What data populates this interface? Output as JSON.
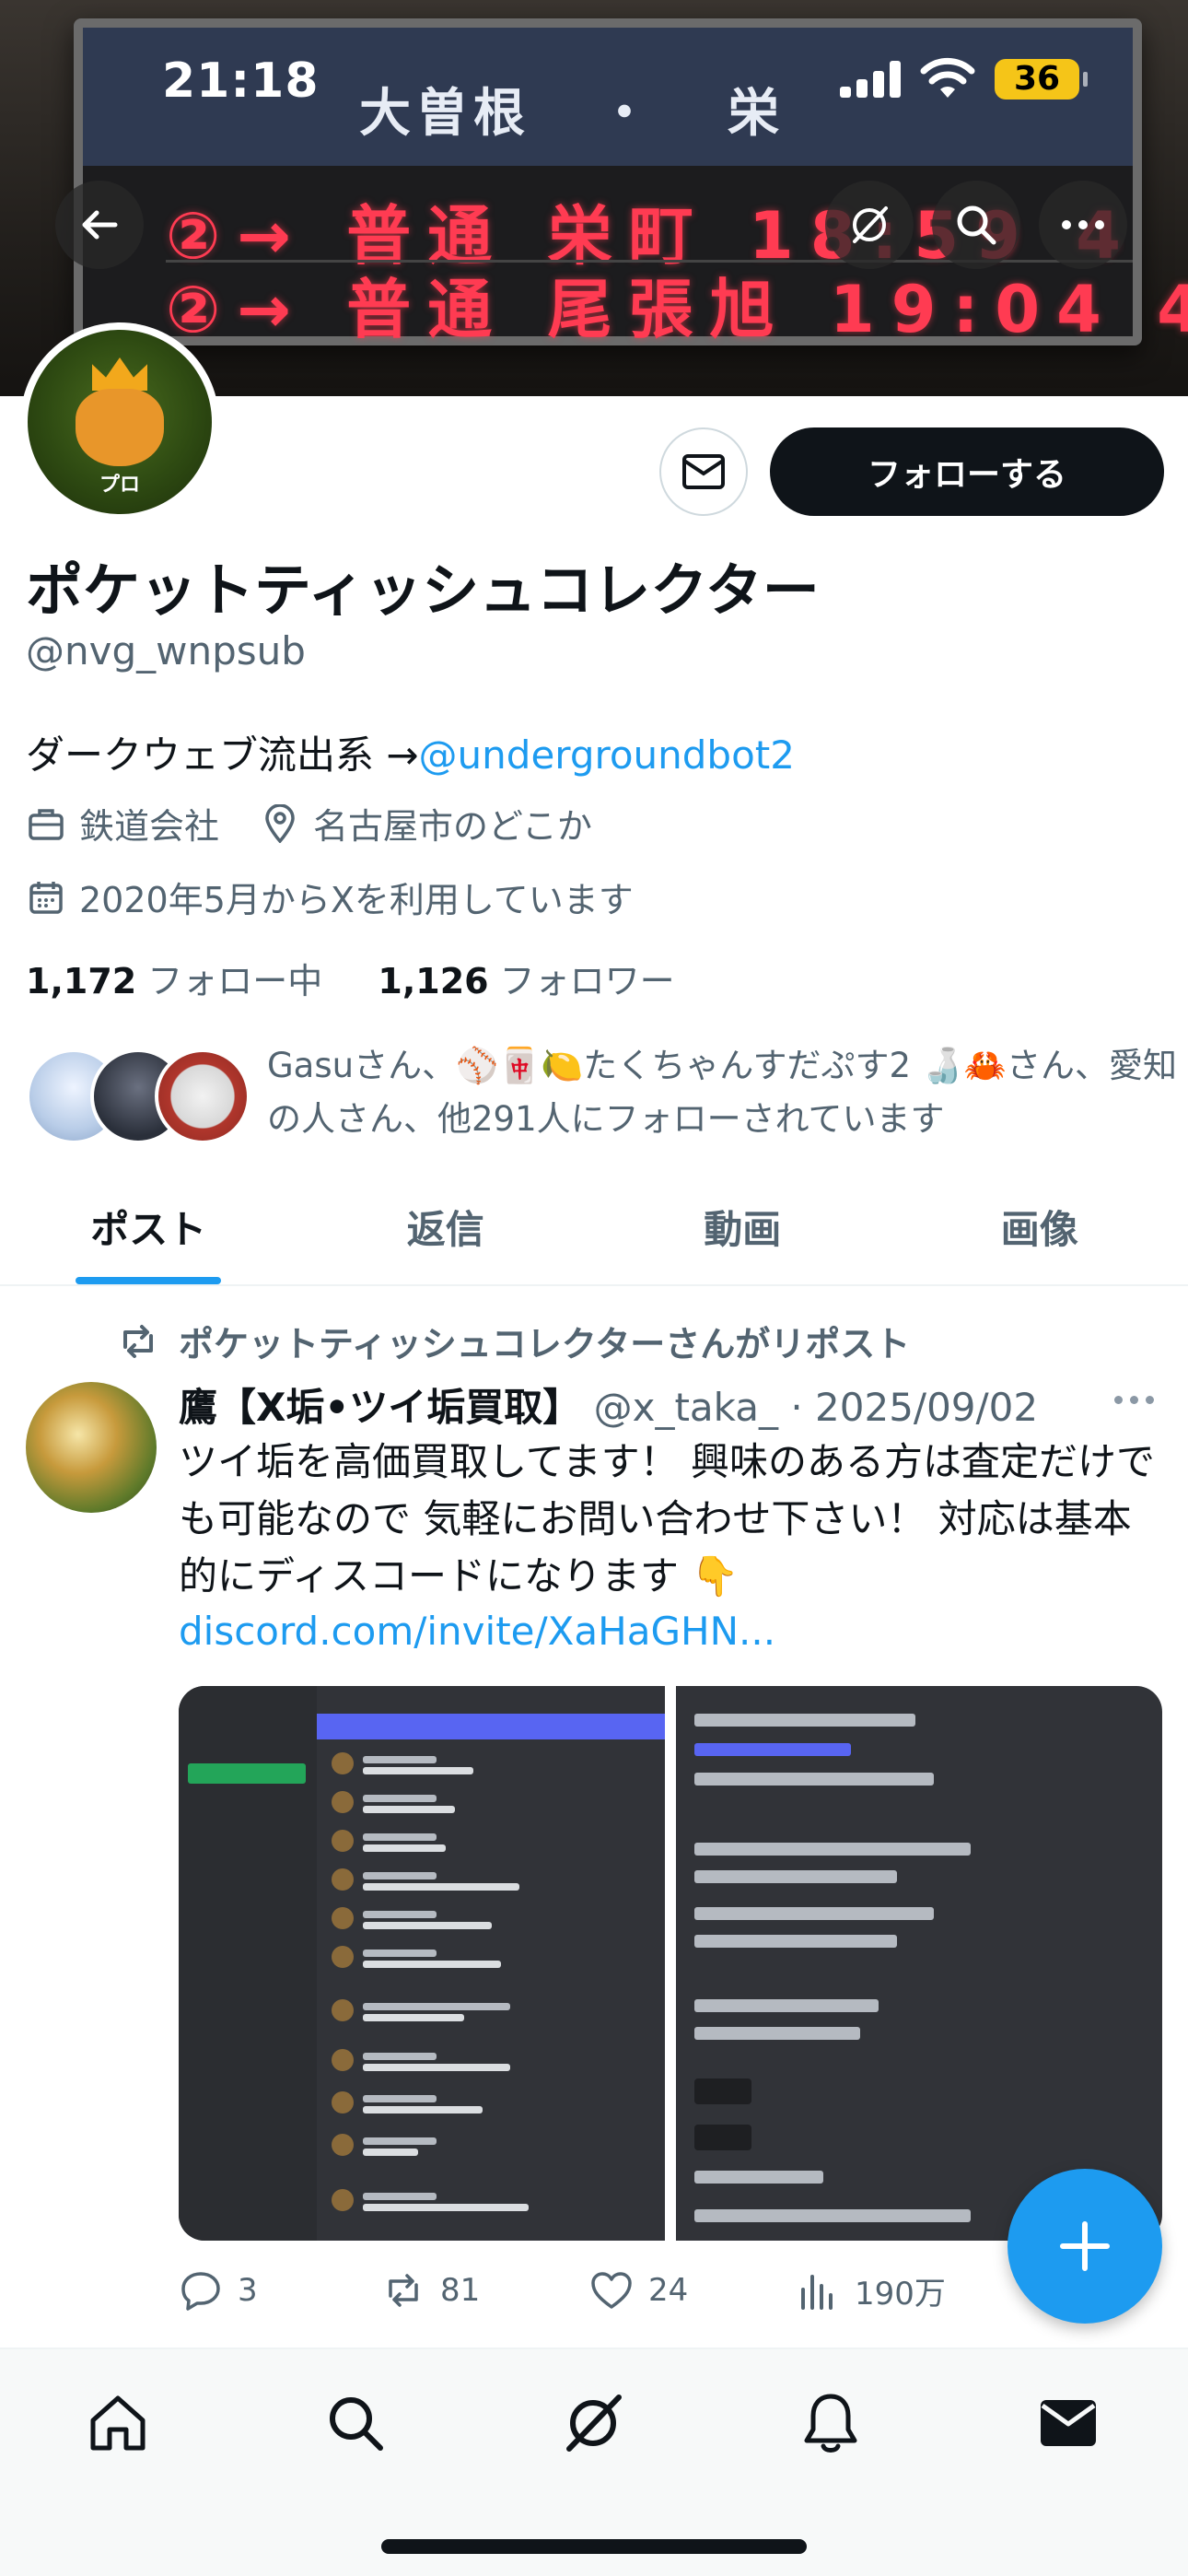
{
  "status_bar": {
    "time": "21:18",
    "battery": "36"
  },
  "banner": {
    "station_left": "大曽根",
    "station_dot": "・",
    "station_right": "栄",
    "row1": "②→ 普通 栄町  18:59 4",
    "row2": "②→ 普通 尾張旭 19:04 4",
    "icons": [
      "back-arrow-icon",
      "grok-icon",
      "search-icon",
      "more-icon"
    ]
  },
  "profile": {
    "avatar_text": "プロ",
    "follow_label": "フォローする",
    "display_name": "ポケットティッシュコレクター",
    "handle": "@nvg_wnpsub",
    "bio_text": "ダークウェブ流出系 →",
    "bio_link": "@undergroundbot2",
    "job": "鉄道会社",
    "location": "名古屋市のどこか",
    "joined": "2020年5月からXを利用しています",
    "following_count": "1,172",
    "following_label": "フォロー中",
    "followers_count": "1,126",
    "followers_label": "フォロワー",
    "known_followers": "Gasuさん、⚾🀄🍋たくちゃんすだぷす2 🍶🦀さん、愛知の人さん、他291人にフォローされています"
  },
  "tabs": [
    {
      "label": "ポスト",
      "active": true
    },
    {
      "label": "返信",
      "active": false
    },
    {
      "label": "動画",
      "active": false
    },
    {
      "label": "画像",
      "active": false
    }
  ],
  "post": {
    "repost_label": "ポケットティッシュコレクターさんがリポスト",
    "author_name": "鷹【X垢•ツイ垢買取】",
    "author_handle": "@x_taka_",
    "separator": " · ",
    "date": "2025/09/02",
    "text": "ツイ垢を高価買取してます！ 興味のある方は査定だけでも可能なので 気軽にお問い合わせ下さい！ 対応は基本的にディスコードになります 👇",
    "link": "discord.com/invite/XaHaGHN...",
    "replies": "3",
    "reposts": "81",
    "likes": "24",
    "views": "190万"
  },
  "colors": {
    "accent": "#1d9bf0",
    "text_primary": "#0f1419",
    "text_secondary": "#536471",
    "follow_button": "#0f1419"
  },
  "nav": [
    "home-icon",
    "search-icon",
    "grok-icon",
    "notifications-icon",
    "messages-icon"
  ]
}
